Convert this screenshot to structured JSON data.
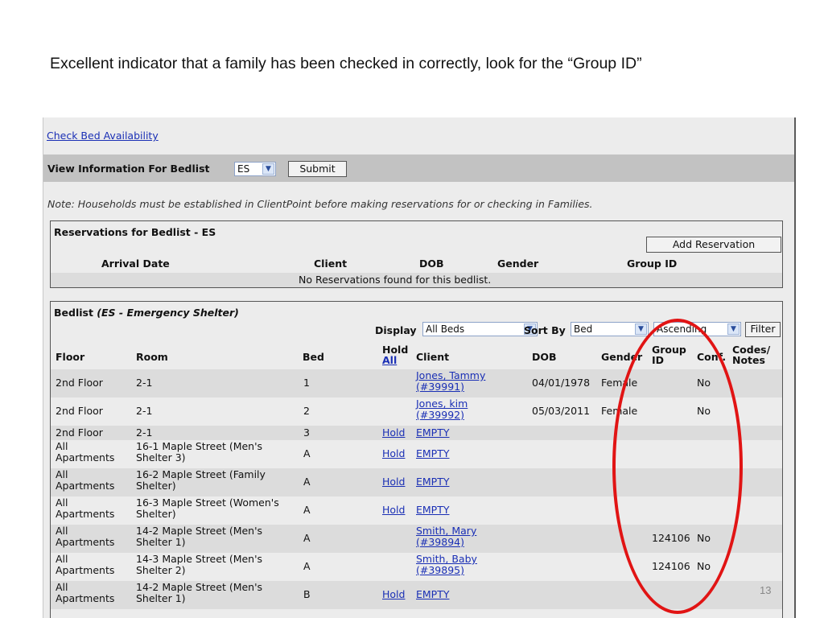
{
  "caption": "Excellent indicator  that a family has been checked in correctly, look for the “Group ID”",
  "links": {
    "check_bed_availability": "Check Bed Availability"
  },
  "view_bar": {
    "label": "View Information For Bedlist",
    "bedlist_value": "ES",
    "submit_label": "Submit"
  },
  "note": "Note: Households must be established in ClientPoint before making reservations for or checking in Families.",
  "reservations": {
    "title": "Reservations for Bedlist - ES",
    "add_label": "Add Reservation",
    "headers": {
      "arrival": "Arrival Date",
      "client": "Client",
      "dob": "DOB",
      "gender": "Gender",
      "group": "Group ID"
    },
    "empty_message": "No Reservations found for this bedlist."
  },
  "bedlist": {
    "title_prefix": "Bedlist ",
    "title_em": "(ES - Emergency Shelter)",
    "display_label": "Display",
    "display_value": "All Beds",
    "sort_label": "Sort By",
    "sort_value": "Bed",
    "order_value": "Ascending",
    "filter_label": "Filter",
    "headers": {
      "floor": "Floor",
      "room": "Room",
      "bed": "Bed",
      "hold_1": "Hold",
      "hold_2": "All",
      "client": "Client",
      "dob": "DOB",
      "gender": "Gender",
      "group_1": "Group",
      "group_2": "ID",
      "conf": "Conf.",
      "codes_1": "Codes/",
      "codes_2": "Notes"
    },
    "rows": [
      {
        "floor_1": "2nd Floor",
        "floor_2": "",
        "room_1": "2-1",
        "room_2": "",
        "bed": "1",
        "hold": "",
        "client_1": "Jones, Tammy",
        "client_2": "(#39991)",
        "dob": "04/01/1978",
        "gender": "Female",
        "group": "",
        "conf": "No"
      },
      {
        "floor_1": "2nd Floor",
        "floor_2": "",
        "room_1": "2-1",
        "room_2": "",
        "bed": "2",
        "hold": "",
        "client_1": "Jones, kim",
        "client_2": "(#39992)",
        "dob": "05/03/2011",
        "gender": "Female",
        "group": "",
        "conf": "No"
      },
      {
        "floor_1": "2nd Floor",
        "floor_2": "",
        "room_1": "2-1",
        "room_2": "",
        "bed": "3",
        "hold": "Hold",
        "client_1": "EMPTY",
        "client_2": "",
        "dob": "",
        "gender": "",
        "group": "",
        "conf": ""
      },
      {
        "floor_1": "All",
        "floor_2": "Apartments",
        "room_1": "16-1 Maple Street (Men's",
        "room_2": "Shelter 3)",
        "bed": "A",
        "hold": "Hold",
        "client_1": "EMPTY",
        "client_2": "",
        "dob": "",
        "gender": "",
        "group": "",
        "conf": ""
      },
      {
        "floor_1": "All",
        "floor_2": "Apartments",
        "room_1": "16-2 Maple Street (Family",
        "room_2": "Shelter)",
        "bed": "A",
        "hold": "Hold",
        "client_1": "EMPTY",
        "client_2": "",
        "dob": "",
        "gender": "",
        "group": "",
        "conf": ""
      },
      {
        "floor_1": "All",
        "floor_2": "Apartments",
        "room_1": "16-3 Maple Street (Women's",
        "room_2": "Shelter)",
        "bed": "A",
        "hold": "Hold",
        "client_1": "EMPTY",
        "client_2": "",
        "dob": "",
        "gender": "",
        "group": "",
        "conf": ""
      },
      {
        "floor_1": "All",
        "floor_2": "Apartments",
        "room_1": "14-2 Maple Street (Men's",
        "room_2": "Shelter 1)",
        "bed": "A",
        "hold": "",
        "client_1": "Smith, Mary",
        "client_2": "(#39894)",
        "dob": "",
        "gender": "",
        "group": "124106",
        "conf": "No"
      },
      {
        "floor_1": "All",
        "floor_2": "Apartments",
        "room_1": "14-3 Maple Street (Men's",
        "room_2": "Shelter 2)",
        "bed": "A",
        "hold": "",
        "client_1": "Smith, Baby",
        "client_2": "(#39895)",
        "dob": "",
        "gender": "",
        "group": "124106",
        "conf": "No"
      },
      {
        "floor_1": "All",
        "floor_2": "Apartments",
        "room_1": "14-2 Maple Street (Men's",
        "room_2": "Shelter 1)",
        "bed": "B",
        "hold": "Hold",
        "client_1": "EMPTY",
        "client_2": "",
        "dob": "",
        "gender": "",
        "group": "",
        "conf": ""
      }
    ]
  },
  "annotation_color": "#e11414",
  "page_number": "13"
}
